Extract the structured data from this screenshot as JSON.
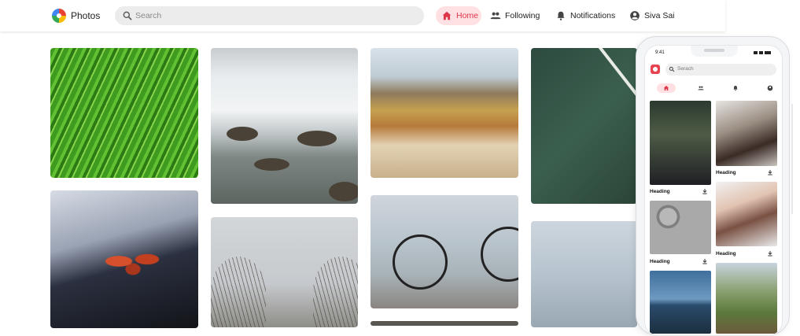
{
  "app": {
    "brand": "Photos"
  },
  "search": {
    "placeholder": "Search"
  },
  "nav": {
    "home": "Home",
    "following": "Following",
    "notifications": "Notifications",
    "user": "Siva Sai"
  },
  "icons": [
    "photos-logo-icon",
    "search-icon",
    "home-icon",
    "people-icon",
    "bell-icon",
    "account-icon",
    "download-icon"
  ],
  "colors": {
    "accent": "#e0364a",
    "accent_bg": "#ffe1e3",
    "search_bg": "#ececec"
  },
  "gallery": {
    "images": [
      "grass-photo",
      "flower-photo",
      "waterfall-photo",
      "tree-photo",
      "valley-photo",
      "bicycle-photo",
      "tennis-photo",
      "sky-photo"
    ]
  },
  "phone": {
    "time": "9:41",
    "search_placeholder": "Serach",
    "cards": [
      {
        "heading": "Heading"
      },
      {
        "heading": "Heading"
      },
      {
        "heading": "Heading"
      },
      {
        "heading": "Heading"
      }
    ]
  }
}
